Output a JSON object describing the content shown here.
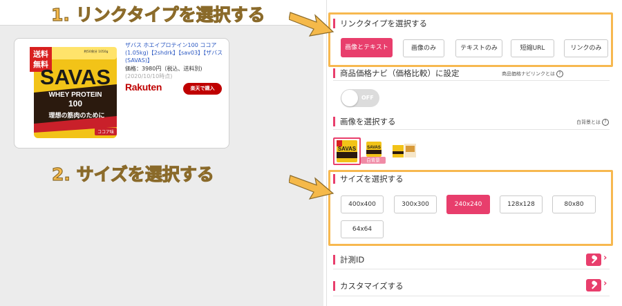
{
  "annotations": {
    "step1": "1. リンクタイプを選択する",
    "step2": "2. サイズを選択する"
  },
  "product_card": {
    "title": "ザバス ホエイプロテイン100 ココア(1.05kg)【2shdrk】【sav03】【ザバス(SAVAS)】",
    "price": "価格：3980円（税込、送料別)",
    "date": "(2020/10/10時点)",
    "store_logo": "Rakuten",
    "buy_button": "楽天で購入",
    "package": {
      "stamp_top": "送料",
      "stamp_bottom": "無料",
      "brand": "SAVAS",
      "line1": "WHEY PROTEIN",
      "line2": "100",
      "tagline": "理想の筋肉のために",
      "flavor": "ココア味",
      "weight": "約50食分 1050g"
    }
  },
  "link_type": {
    "title": "リンクタイプを選択する",
    "options": [
      "画像とテキスト",
      "画像のみ",
      "テキストのみ",
      "短縮URL",
      "リンクのみ"
    ],
    "selected": "画像とテキスト"
  },
  "price_nav": {
    "title": "商品価格ナビ（価格比較）に設定",
    "help": "商品価格ナビリンクとは",
    "toggle_label": "OFF",
    "toggle_on": false
  },
  "image_select": {
    "title": "画像を選択する",
    "help": "白背景とは",
    "white_bg_badge": "白背景",
    "thumbnails": [
      "main-package",
      "white-background-package",
      "package-set"
    ],
    "selected_index": 0
  },
  "size_select": {
    "title": "サイズを選択する",
    "options": [
      "400x400",
      "300x300",
      "240x240",
      "128x128",
      "80x80",
      "64x64"
    ],
    "selected": "240x240"
  },
  "tracking": {
    "title": "計測ID"
  },
  "customize": {
    "title": "カスタマイズする"
  },
  "colors": {
    "accent": "#e83e6c",
    "highlight": "#f7b84f",
    "rakuten": "#bf0000"
  }
}
